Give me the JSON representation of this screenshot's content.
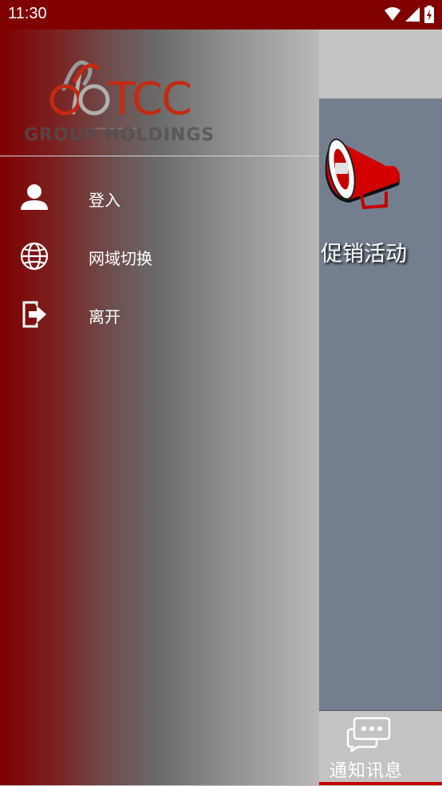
{
  "status_bar": {
    "time": "11:30"
  },
  "header": {
    "glyph": ")"
  },
  "main": {
    "promo_label": "促销活动"
  },
  "bottom_nav": {
    "label": "通知讯息"
  },
  "drawer": {
    "logo_text": "TCC",
    "logo_subtext": "GROUP HOLDINGS",
    "items": [
      {
        "label": "登入",
        "icon": "user-icon"
      },
      {
        "label": "网域切换",
        "icon": "globe-icon"
      },
      {
        "label": "离开",
        "icon": "exit-icon"
      }
    ]
  },
  "colors": {
    "brand": "#800000",
    "accent": "#c50000"
  }
}
